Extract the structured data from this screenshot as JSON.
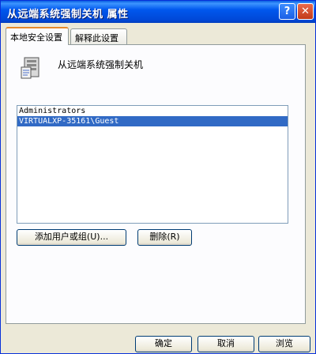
{
  "window": {
    "title": "从远端系统强制关机 属性",
    "help_button": "?",
    "close_button": "✕"
  },
  "tabs": [
    {
      "label": "本地安全设置"
    },
    {
      "label": "解释此设置"
    }
  ],
  "policy": {
    "name": "从远端系统强制关机",
    "icon": "server-policy-icon"
  },
  "list": {
    "items": [
      {
        "label": "Administrators",
        "selected": false
      },
      {
        "label": "VIRTUALXP-35161\\Guest",
        "selected": true
      }
    ]
  },
  "buttons": {
    "add": "添加用户或组(U)...",
    "remove": "删除(R)",
    "ok": "确定",
    "cancel": "取消",
    "browse": "浏览"
  },
  "colors": {
    "titlebar": "#0058ee",
    "selection": "#316ac5",
    "close_button": "#c23a19",
    "active_tab_accent": "#e68b2c"
  }
}
